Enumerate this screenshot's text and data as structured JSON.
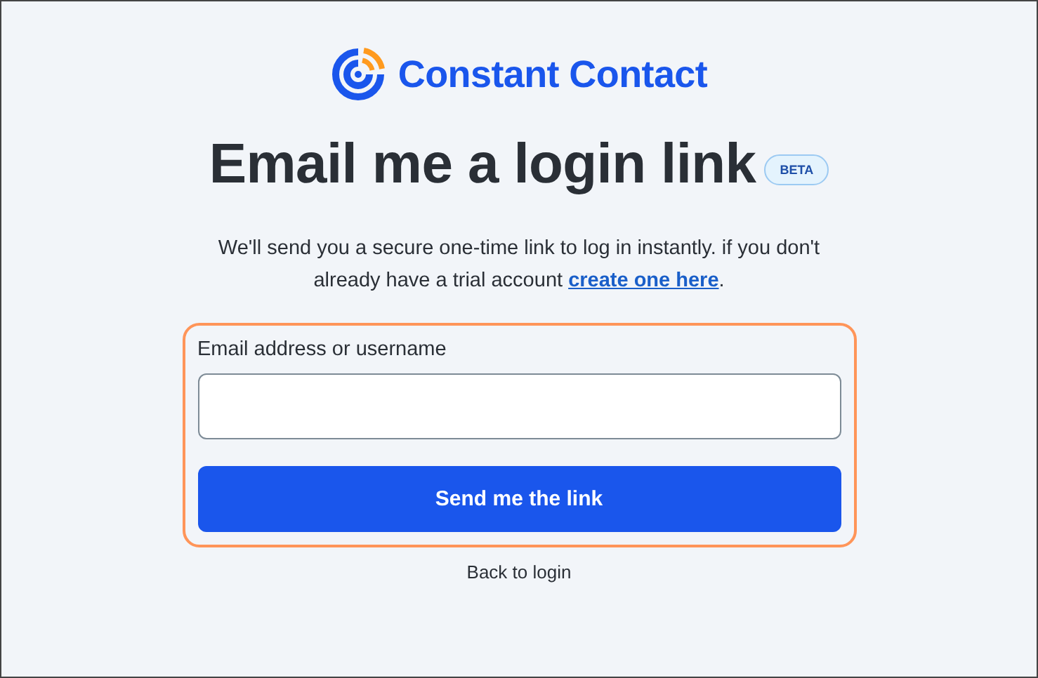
{
  "logo": {
    "text": "Constant Contact"
  },
  "heading": {
    "title": "Email me a login link",
    "badge": "BETA"
  },
  "description": {
    "text": "We'll send you a secure one-time link to log in instantly. if you don't already have a trial account ",
    "link": "create one here",
    "after": "."
  },
  "form": {
    "highlighted": true,
    "label": "Email address or username",
    "button": "Send me the link"
  },
  "back_link": "Back to login"
}
